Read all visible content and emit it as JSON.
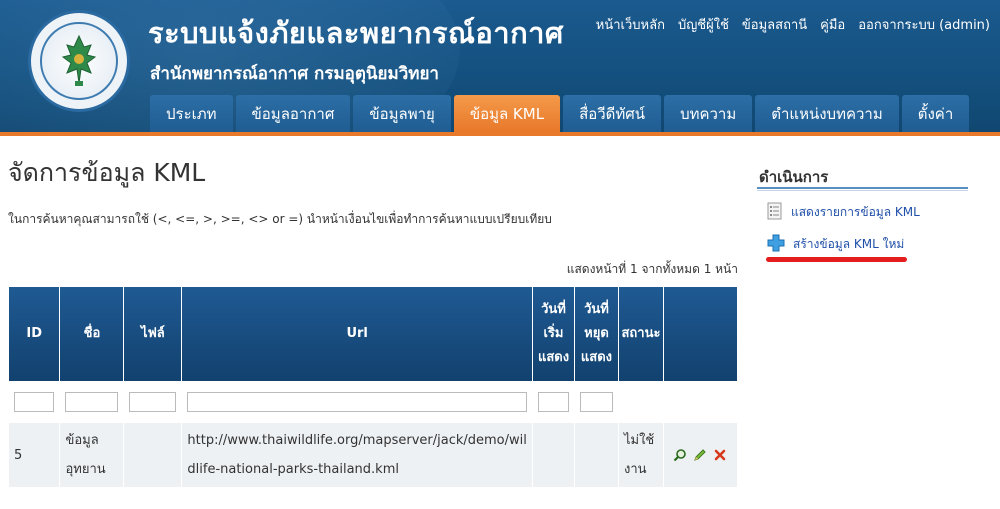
{
  "header": {
    "site_title": "ระบบแจ้งภัยและพยากรณ์อากาศ",
    "site_subtitle": "สำนักพยากรณ์อากาศ กรมอุตุนิยมวิทยา",
    "logo_text": "METEOROLOGICAL DEPARTMENT",
    "top_links": [
      "หน้าเว็บหลัก",
      "บัญชีผู้ใช้",
      "ข้อมูลสถานี",
      "คู่มือ",
      "ออกจากระบบ (admin)"
    ],
    "nav_tabs": [
      "ประเภท",
      "ข้อมูลอากาศ",
      "ข้อมูลพายุ",
      "ข้อมูล KML",
      "สื่อวีดีทัศน์",
      "บทความ",
      "ตำแหน่งบทความ",
      "ตั้งค่า"
    ],
    "active_tab": "ข้อมูล KML"
  },
  "main": {
    "title": "จัดการข้อมูล KML",
    "hint": "ในการค้นหาคุณสามารถใช้ (<, <=, >, >=, <> or =) นำหน้าเงื่อนไขเพื่อทำการค้นหาแบบเปรียบเทียบ",
    "summary": "แสดงหน้าที่ 1 จากทั้งหมด 1 หน้า",
    "table": {
      "columns": [
        "ID",
        "ชื่อ",
        "ไฟล์",
        "Url",
        "วันที่ เริ่ม แสดง",
        "วันที่ หยุด แสดง",
        "สถานะ",
        ""
      ],
      "rows": [
        {
          "id": "5",
          "name": "ข้อมูล อุทยาน",
          "file": "",
          "url": "http://www.thaiwildlife.org/mapserver/jack/demo/wildlife-national-parks-thailand.kml",
          "start": "",
          "stop": "",
          "status": "ไม่ใช้ งาน"
        }
      ]
    }
  },
  "sidebar": {
    "title": "ดำเนินการ",
    "items": [
      {
        "label": "แสดงรายการข้อมูล KML",
        "icon": "list-icon"
      },
      {
        "label": "สร้างข้อมูล KML ใหม่",
        "icon": "plus-icon"
      }
    ]
  },
  "colors": {
    "header_bg": "#14507f",
    "accent_orange": "#e8782a",
    "table_header": "#1a4f82",
    "link": "#1f4fa8",
    "highlight_underline": "#e41e1e"
  }
}
